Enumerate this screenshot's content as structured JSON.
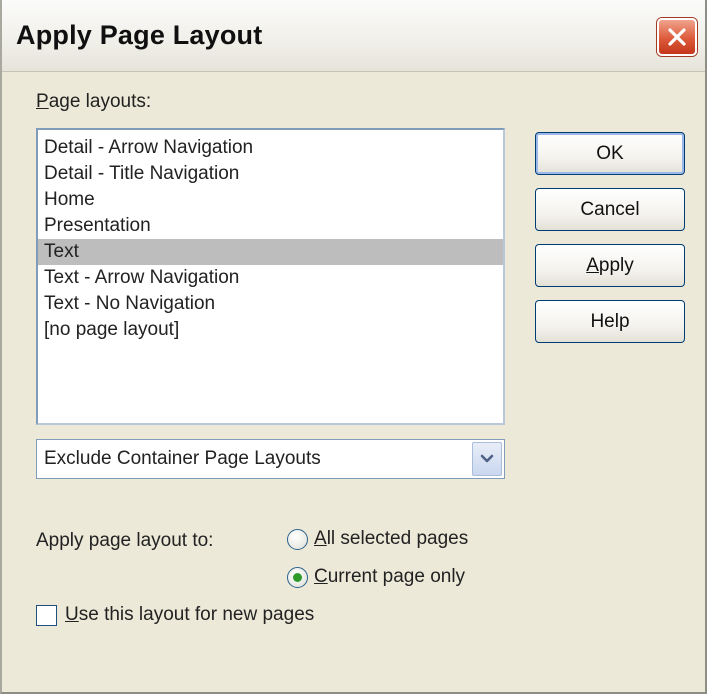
{
  "window": {
    "title": "Apply Page Layout"
  },
  "page_layouts_label": "Page layouts:",
  "page_layouts": {
    "items": [
      "Detail - Arrow Navigation",
      "Detail - Title Navigation",
      "Home",
      "Presentation",
      "Text",
      "Text - Arrow Navigation",
      "Text - No Navigation",
      "[no page layout]"
    ],
    "selected_index": 4
  },
  "buttons": {
    "ok": "OK",
    "cancel": "Cancel",
    "apply": "Apply",
    "help": "Help"
  },
  "filter_select": {
    "value": "Exclude Container Page Layouts"
  },
  "apply_to": {
    "label": "Apply page layout to:",
    "options": [
      "All selected pages",
      "Current page only"
    ],
    "selected_index": 1
  },
  "new_pages_checkbox": {
    "label": "Use this layout for new pages",
    "checked": false
  },
  "colors": {
    "window_bg": "#ece9d8",
    "selection_bg": "#bdbdbd",
    "close_button": "#dd5a3a",
    "radio_dot": "#2e9a2a"
  },
  "icons": {
    "close": "close-icon",
    "dropdown": "chevron-down-icon"
  }
}
